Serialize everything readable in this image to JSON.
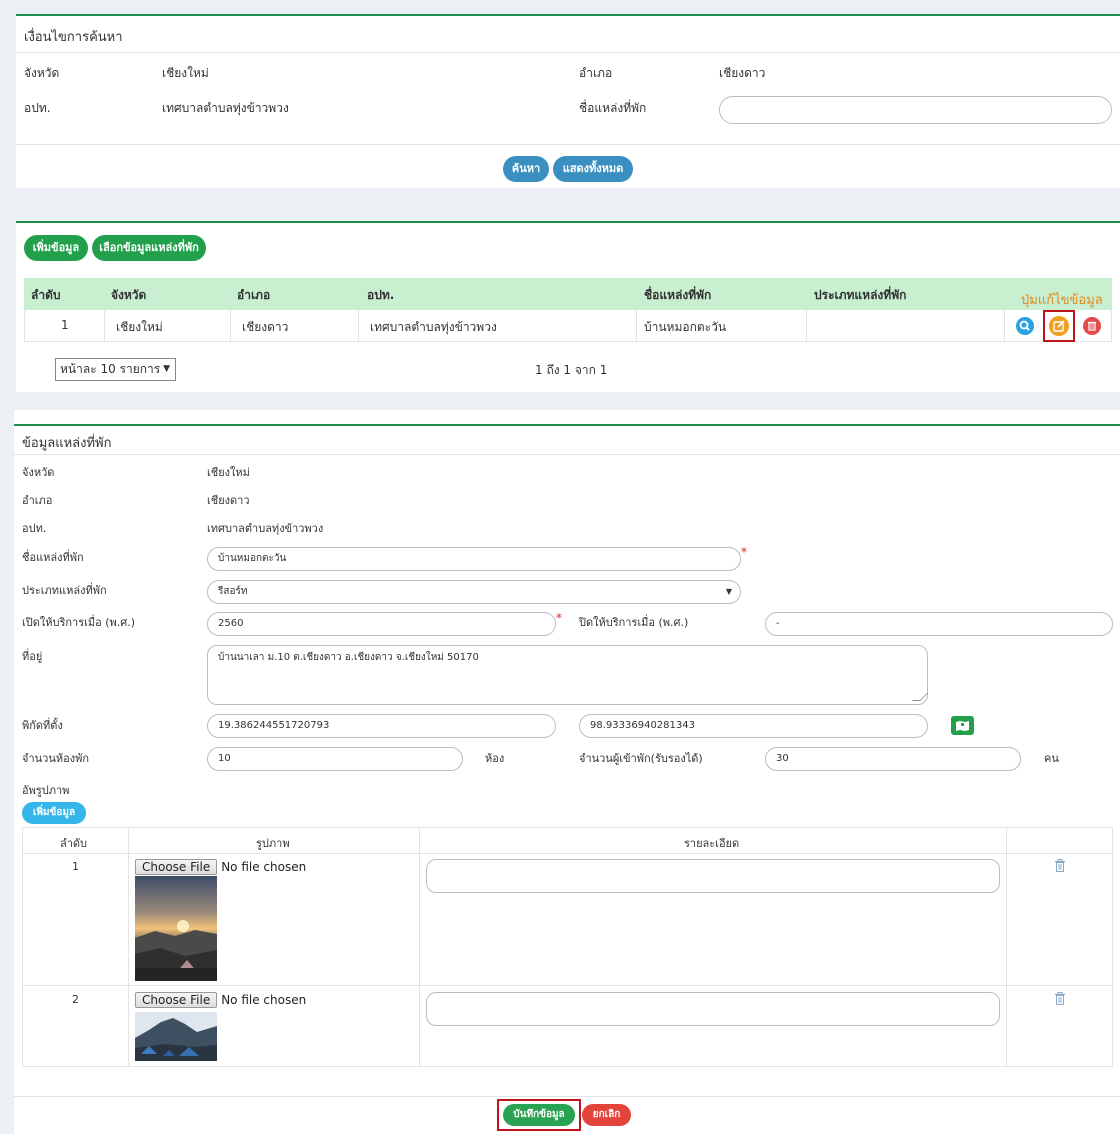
{
  "search": {
    "title": "เงื่อนไขการค้นหา",
    "province_label": "จังหวัด",
    "province_value": "เชียงใหม่",
    "district_label": "อำเภอ",
    "district_value": "เชียงดาว",
    "local_label": "อปท.",
    "local_value": "เทศบาลตำบลทุ่งข้าวพวง",
    "name_label": "ชื่อแหล่งที่พัก",
    "name_value": "",
    "search_btn": "ค้นหา",
    "show_all_btn": "แสดงทั้งหมด"
  },
  "results": {
    "add_btn": "เพิ่มข้อมูล",
    "select_btn": "เลือกข้อมูลแหล่งที่พัก",
    "columns": [
      "ลำดับ",
      "จังหวัด",
      "อำเภอ",
      "อปท.",
      "ชื่อแหล่งที่พัก",
      "ประเภทแหล่งที่พัก"
    ],
    "edit_annotation": "ปุ่มแก้ไขข้อมูล",
    "rows": [
      {
        "no": "1",
        "province": "เชียงใหม่",
        "district": "เชียงดาว",
        "local": "เทศบาลตำบลทุ่งข้าวพวง",
        "name": "บ้านหมอกตะวัน",
        "type": ""
      }
    ],
    "page_size": "หน้าละ 10 รายการ",
    "pagination": "1 ถึง 1 จาก 1",
    "colors": {
      "header_bg": "#c8efd0",
      "view": "#2aa2e0",
      "edit": "#f0a020",
      "delete": "#e34c4c"
    }
  },
  "form": {
    "title": "ข้อมูลแหล่งที่พัก",
    "province_label": "จังหวัด",
    "province_value": "เชียงใหม่",
    "district_label": "อำเภอ",
    "district_value": "เชียงดาว",
    "local_label": "อปท.",
    "local_value": "เทศบาลตำบลทุ่งข้าวพวง",
    "name_label": "ชื่อแหล่งที่พัก",
    "name_value": "บ้านหมอกตะวัน",
    "type_label": "ประเภทแหล่งที่พัก",
    "type_value": "รีสอร์ท",
    "open_label": "เปิดให้บริการเมื่อ (พ.ศ.)",
    "open_value": "2560",
    "close_label": "ปิดให้บริการเมื่อ (พ.ศ.)",
    "close_value": "-",
    "address_label": "ที่อยู่",
    "address_value": "บ้านนาเลา ม.10 ต.เชียงดาว อ.เชียงดาว จ.เชียงใหม่ 50170",
    "coord_label": "พิกัดที่ตั้ง",
    "lat_value": "19.386244551720793",
    "lng_value": "98.93336940281343",
    "rooms_label": "จำนวนห้องพัก",
    "rooms_value": "10",
    "rooms_unit": "ห้อง",
    "guests_label": "จำนวนผู้เข้าพัก(รับรองได้)",
    "guests_value": "30",
    "guests_unit": "คน",
    "upload_label": "อัพรูปภาพ",
    "add_btn": "เพิ่มข้อมูล",
    "image_columns": [
      "ลำดับ",
      "รูปภาพ",
      "รายละเอียด"
    ],
    "choose_file": "Choose File",
    "no_file": "No file chosen",
    "images": [
      {
        "no": "1",
        "detail": ""
      },
      {
        "no": "2",
        "detail": ""
      }
    ],
    "save_btn": "บันทึกข้อมูล",
    "cancel_btn": "ยกเลิก",
    "required_mark": "*"
  }
}
